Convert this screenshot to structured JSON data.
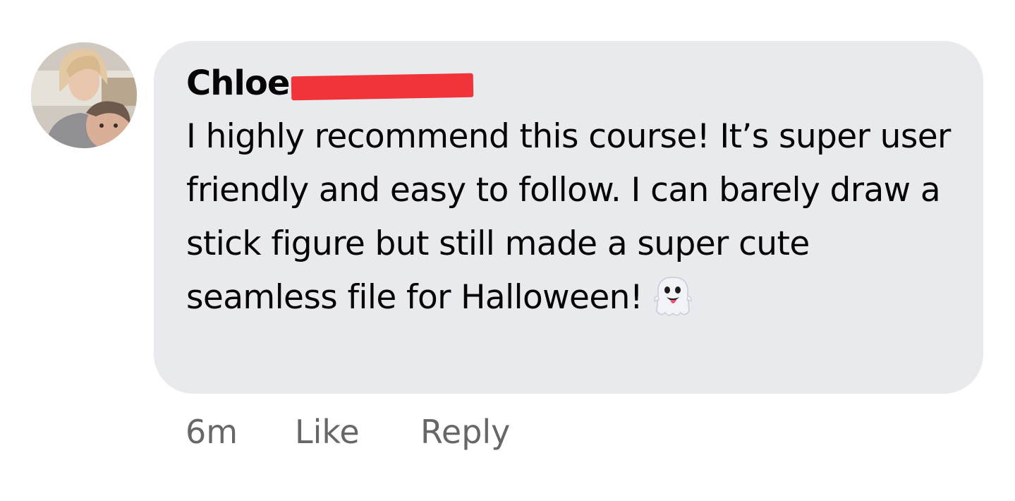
{
  "comment": {
    "author_first_name": "Chloe",
    "text": "I highly recommend this course! It’s super user friendly and easy to follow. I can barely draw a stick figure but still made a super cute seamless file for Halloween!",
    "emoji_icon": "ghost-icon",
    "timestamp": "6m",
    "like_label": "Like",
    "reply_label": "Reply"
  },
  "colors": {
    "bubble": "#e9eaee",
    "meta_text": "#65676b",
    "redaction": "#f0343a"
  }
}
